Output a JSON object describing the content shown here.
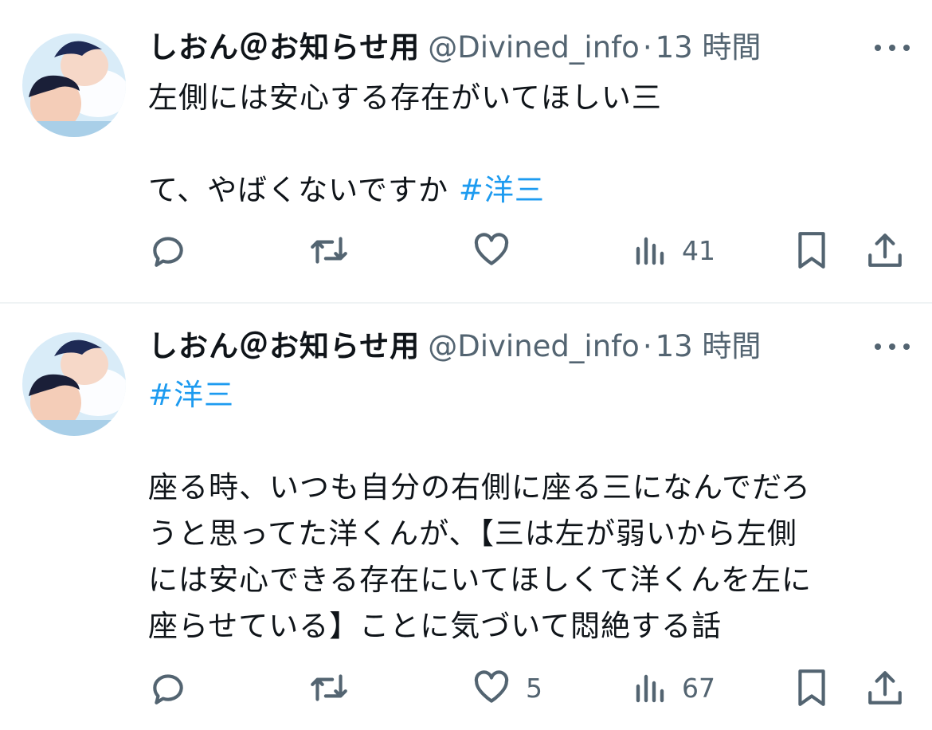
{
  "tweets": [
    {
      "display_name": "しおん＠お知らせ用",
      "handle": "@Divined_info",
      "separator": "·",
      "time": "13 時間",
      "lines": [
        {
          "text": "左側には安心する存在がいてほしい三",
          "hashtag": ""
        },
        {
          "text": "",
          "hashtag": ""
        },
        {
          "text": "て、やばくないですか ",
          "hashtag": "#洋三"
        }
      ],
      "actions": {
        "reply_count": "",
        "retweet_count": "",
        "like_count": "",
        "views_count": "41"
      }
    },
    {
      "display_name": "しおん＠お知らせ用",
      "handle": "@Divined_info",
      "separator": "·",
      "time": "13 時間",
      "lines": [
        {
          "text": "",
          "hashtag": "#洋三"
        },
        {
          "text": "",
          "hashtag": ""
        },
        {
          "text": "座る時、いつも自分の右側に座る三になんでだろ",
          "hashtag": ""
        },
        {
          "text": "うと思ってた洋くんが、【三は左が弱いから左側",
          "hashtag": ""
        },
        {
          "text": "には安心できる存在にいてほしくて洋くんを左に",
          "hashtag": ""
        },
        {
          "text": "座らせている】ことに気づいて悶絶する話",
          "hashtag": ""
        }
      ],
      "actions": {
        "reply_count": "",
        "retweet_count": "",
        "like_count": "5",
        "views_count": "67"
      }
    }
  ],
  "icons": {
    "reply": "speech-bubble-icon",
    "retweet": "retweet-arrows-icon",
    "like": "heart-icon",
    "views": "bar-chart-icon",
    "bookmark": "bookmark-icon",
    "share": "share-upload-icon",
    "more": "more-dots-icon"
  },
  "colors": {
    "text": "#0f1419",
    "secondary": "#536471",
    "hashtag": "#1d9bf0",
    "divider": "#eff3f4"
  }
}
